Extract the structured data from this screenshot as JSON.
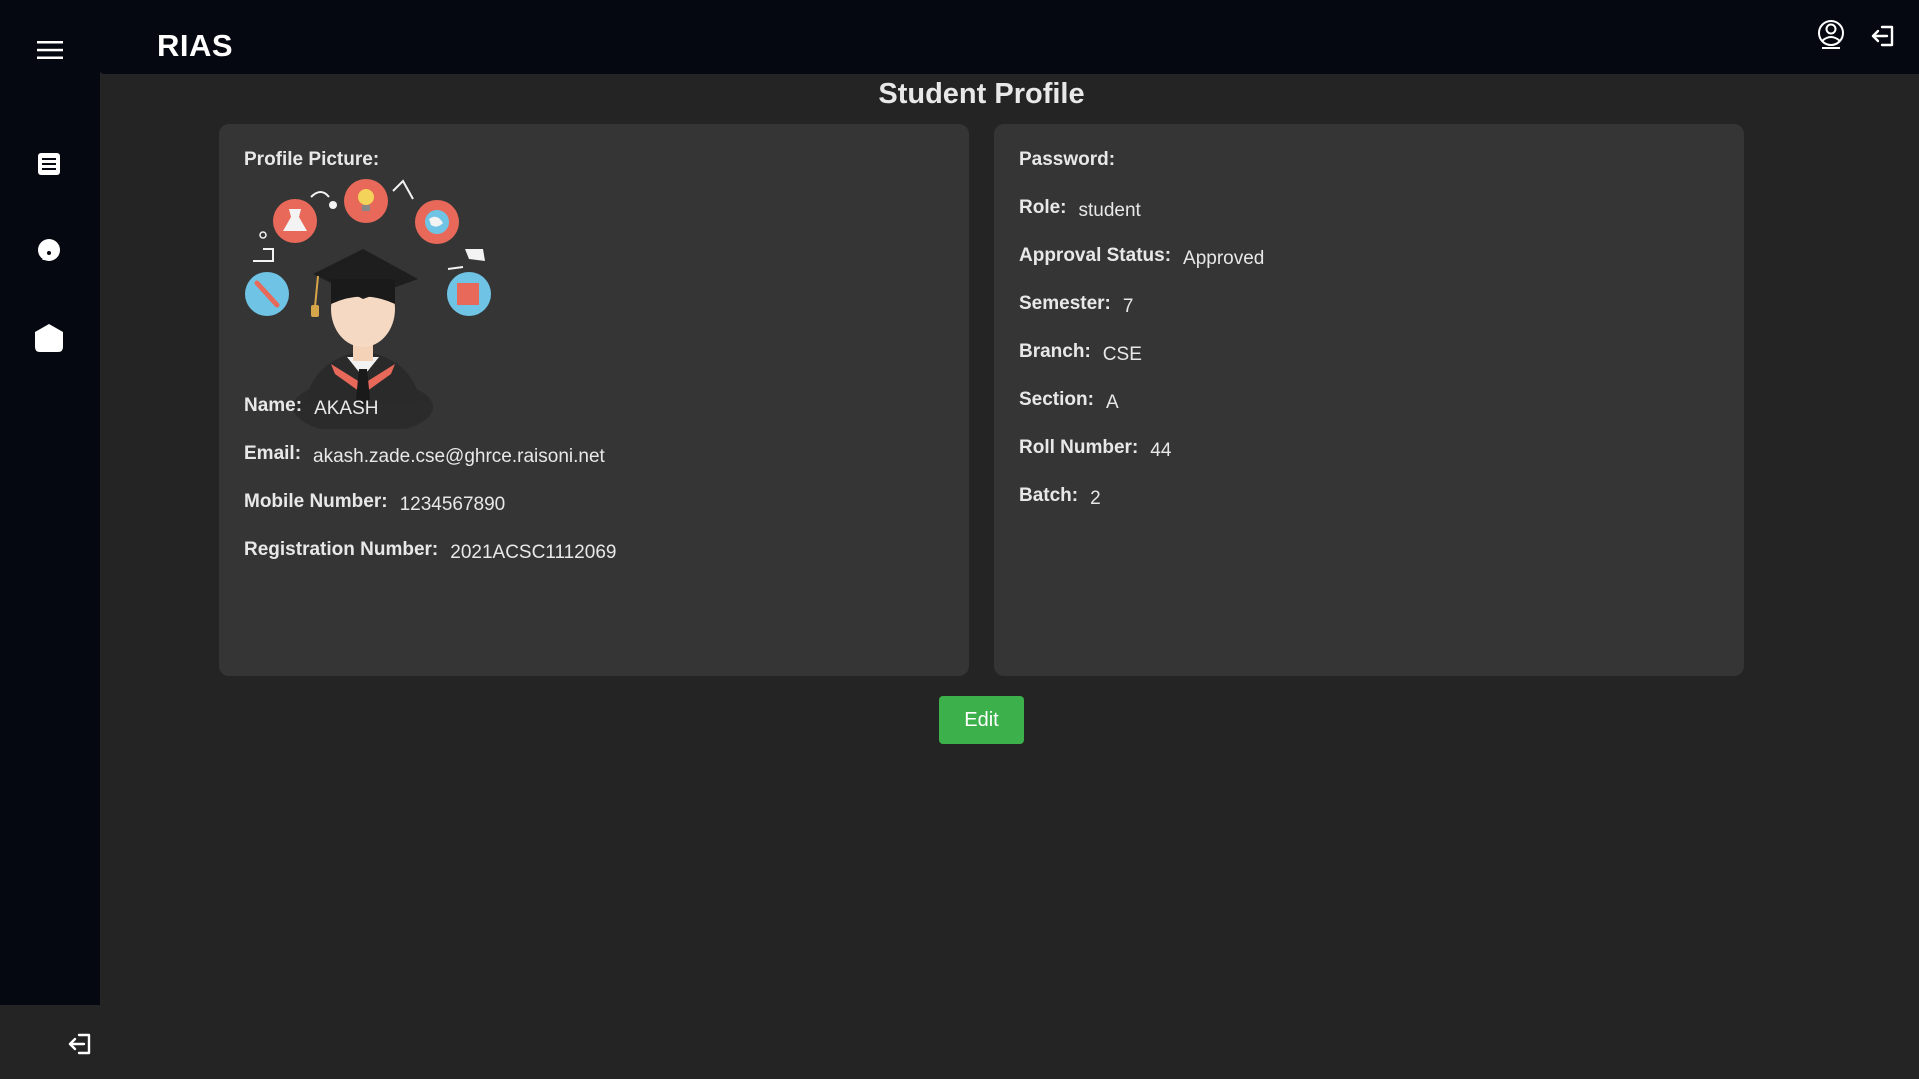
{
  "app": {
    "brand": "RIAS"
  },
  "page": {
    "title": "Student Profile"
  },
  "sidebar": {
    "items": [
      {
        "icon": "menu-icon"
      },
      {
        "icon": "list-icon"
      },
      {
        "icon": "chat-icon"
      },
      {
        "icon": "home-icon"
      }
    ],
    "footer_icon": "logout-icon"
  },
  "header": {
    "icons": [
      "user-icon",
      "logout-icon"
    ]
  },
  "profile": {
    "picture_label": "Profile Picture:",
    "left_fields": [
      {
        "label": "Name:",
        "value": "AKASH"
      },
      {
        "label": "Email:",
        "value": "akash.zade.cse@ghrce.raisoni.net"
      },
      {
        "label": "Mobile Number:",
        "value": "1234567890"
      },
      {
        "label": "Registration Number:",
        "value": "2021ACSC1112069"
      }
    ],
    "right_fields": [
      {
        "label": "Password:",
        "value": ""
      },
      {
        "label": "Role:",
        "value": "student"
      },
      {
        "label": "Approval Status:",
        "value": "Approved"
      },
      {
        "label": "Semester:",
        "value": "7"
      },
      {
        "label": "Branch:",
        "value": "CSE"
      },
      {
        "label": "Section:",
        "value": "A"
      },
      {
        "label": "Roll Number:",
        "value": "44"
      },
      {
        "label": "Batch:",
        "value": "2"
      }
    ]
  },
  "actions": {
    "edit_label": "Edit"
  },
  "colors": {
    "background": "#242424",
    "sidebar": "#050810",
    "card": "#353535",
    "accent": "#3cb04a"
  }
}
